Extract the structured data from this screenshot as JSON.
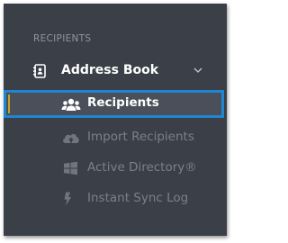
{
  "sidebar": {
    "section_heading": "RECIPIENTS",
    "group": {
      "label": "Address Book",
      "icon": "address-book-icon",
      "expanded": true
    },
    "items": [
      {
        "label": "Recipients",
        "icon": "users-icon",
        "active": true
      },
      {
        "label": "Import Recipients",
        "icon": "cloud-upload-icon",
        "active": false
      },
      {
        "label": "Active Directory®",
        "icon": "windows-icon",
        "active": false
      },
      {
        "label": "Instant Sync Log",
        "icon": "bolt-icon",
        "active": false
      }
    ]
  },
  "colors": {
    "sidebar_bg": "#3a3f48",
    "active_bg": "#4a4f59",
    "highlight_border": "#1f86d2",
    "muted_text": "#7a818b",
    "active_text": "#ffffff"
  }
}
